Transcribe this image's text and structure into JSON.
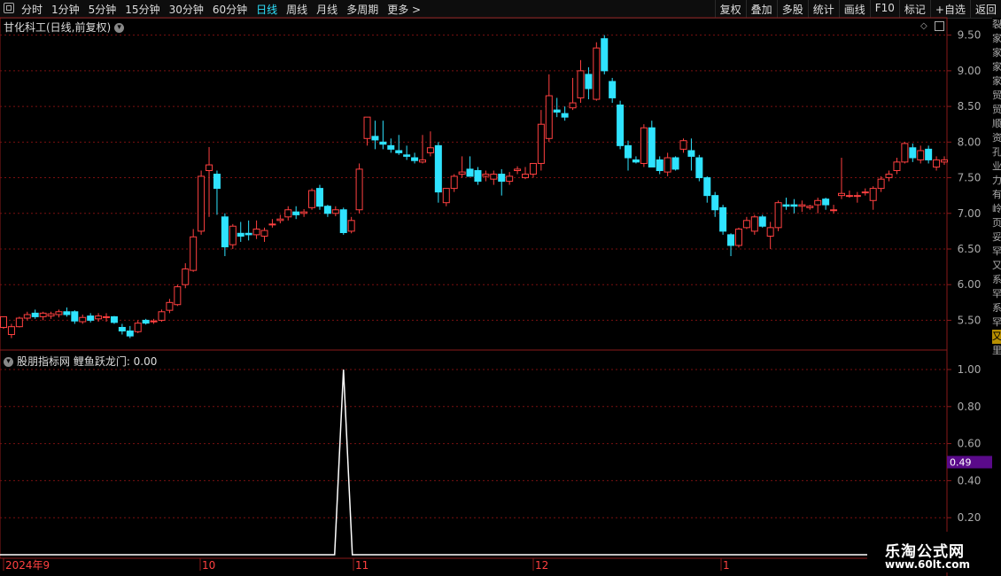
{
  "toolbar": {
    "periods": [
      "分时",
      "1分钟",
      "5分钟",
      "15分钟",
      "30分钟",
      "60分钟",
      "日线",
      "周线",
      "月线",
      "多周期",
      "更多 >"
    ],
    "active_period": "日线",
    "right_buttons": [
      "复权",
      "叠加",
      "多股",
      "统计",
      "画线",
      "F10",
      "标记",
      "+自选",
      "返回"
    ]
  },
  "main_chart": {
    "title": "甘化科工(日线,前复权)",
    "y_ticks": [
      "9.50",
      "9.00",
      "8.50",
      "8.00",
      "7.50",
      "7.00",
      "6.50",
      "6.00",
      "5.50"
    ],
    "y_values": [
      9.5,
      9.0,
      8.5,
      8.0,
      7.5,
      7.0,
      6.5,
      6.0,
      5.5
    ]
  },
  "indicator": {
    "title": "股朋指标网 鲤鱼跃龙门: 0.00",
    "y_ticks": [
      "1.00",
      "0.80",
      "0.60",
      "0.40",
      "0.20"
    ],
    "current_value": "0.49"
  },
  "x_axis": {
    "labels": [
      "2024年9",
      "10",
      "11",
      "12",
      "1"
    ]
  },
  "watermark": {
    "title": "乐淘公式网",
    "url": "www.60lt.com"
  },
  "sidebar_chars": [
    "裂",
    "家",
    "家",
    "家",
    "家",
    "贸",
    "贸",
    "顺",
    "资",
    "孔",
    "业",
    "力",
    "有",
    "岭",
    "",
    "页",
    "妥",
    "罕",
    "又",
    "系",
    "罕",
    "系",
    "罕",
    "又",
    "里"
  ],
  "colors": {
    "up": "#ff4040",
    "down": "#2fe3ff",
    "grid": "#7a1010",
    "axis": "#8a1a1a"
  },
  "chart_data": {
    "type": "candlestick",
    "ohlc": [
      [
        5.4,
        5.55,
        5.38,
        5.55
      ],
      [
        5.3,
        5.45,
        5.25,
        5.41
      ],
      [
        5.41,
        5.55,
        5.4,
        5.53
      ],
      [
        5.53,
        5.62,
        5.5,
        5.58
      ],
      [
        5.6,
        5.65,
        5.52,
        5.55
      ],
      [
        5.55,
        5.62,
        5.5,
        5.6
      ],
      [
        5.56,
        5.62,
        5.52,
        5.59
      ],
      [
        5.58,
        5.65,
        5.54,
        5.62
      ],
      [
        5.62,
        5.68,
        5.55,
        5.58
      ],
      [
        5.62,
        5.64,
        5.45,
        5.49
      ],
      [
        5.48,
        5.58,
        5.45,
        5.54
      ],
      [
        5.56,
        5.6,
        5.47,
        5.5
      ],
      [
        5.52,
        5.6,
        5.48,
        5.56
      ],
      [
        5.55,
        5.6,
        5.48,
        5.55
      ],
      [
        5.55,
        5.56,
        5.45,
        5.47
      ],
      [
        5.4,
        5.45,
        5.3,
        5.35
      ],
      [
        5.35,
        5.42,
        5.25,
        5.28
      ],
      [
        5.34,
        5.5,
        5.32,
        5.46
      ],
      [
        5.5,
        5.52,
        5.44,
        5.46
      ],
      [
        5.48,
        5.52,
        5.45,
        5.49
      ],
      [
        5.5,
        5.65,
        5.48,
        5.62
      ],
      [
        5.64,
        5.8,
        5.6,
        5.75
      ],
      [
        5.72,
        6.0,
        5.7,
        5.97
      ],
      [
        6.0,
        6.3,
        5.95,
        6.22
      ],
      [
        6.2,
        6.78,
        6.18,
        6.67
      ],
      [
        6.75,
        7.6,
        6.7,
        7.52
      ],
      [
        7.6,
        7.93,
        6.95,
        7.68
      ],
      [
        7.55,
        7.6,
        6.98,
        7.35
      ],
      [
        6.95,
        7.0,
        6.4,
        6.53
      ],
      [
        6.56,
        6.85,
        6.5,
        6.82
      ],
      [
        6.72,
        6.88,
        6.6,
        6.68
      ],
      [
        6.72,
        6.9,
        6.62,
        6.7
      ],
      [
        6.7,
        6.9,
        6.64,
        6.78
      ],
      [
        6.68,
        6.8,
        6.6,
        6.76
      ],
      [
        6.85,
        6.92,
        6.8,
        6.85
      ],
      [
        6.9,
        6.98,
        6.86,
        6.92
      ],
      [
        6.95,
        7.1,
        6.9,
        7.05
      ],
      [
        7.02,
        7.1,
        6.92,
        6.98
      ],
      [
        7.0,
        7.06,
        6.95,
        7.02
      ],
      [
        7.08,
        7.35,
        7.05,
        7.32
      ],
      [
        7.35,
        7.4,
        7.05,
        7.1
      ],
      [
        7.1,
        7.12,
        6.95,
        7.0
      ],
      [
        7.0,
        7.1,
        6.96,
        7.05
      ],
      [
        7.05,
        7.08,
        6.7,
        6.73
      ],
      [
        6.75,
        6.95,
        6.72,
        6.9
      ],
      [
        7.05,
        7.7,
        7.0,
        7.62
      ],
      [
        8.05,
        8.35,
        7.95,
        8.35
      ],
      [
        8.08,
        8.3,
        7.9,
        8.03
      ],
      [
        8.0,
        8.3,
        7.9,
        7.97
      ],
      [
        7.95,
        8.05,
        7.85,
        7.9
      ],
      [
        7.88,
        8.1,
        7.82,
        7.85
      ],
      [
        7.82,
        7.95,
        7.75,
        7.8
      ],
      [
        7.78,
        7.85,
        7.7,
        7.74
      ],
      [
        7.72,
        8.1,
        7.7,
        7.75
      ],
      [
        7.85,
        8.15,
        7.8,
        7.92
      ],
      [
        7.95,
        8.0,
        7.15,
        7.3
      ],
      [
        7.15,
        7.3,
        7.1,
        7.35
      ],
      [
        7.35,
        7.55,
        7.3,
        7.52
      ],
      [
        7.55,
        7.8,
        7.5,
        7.58
      ],
      [
        7.62,
        7.8,
        7.58,
        7.52
      ],
      [
        7.6,
        7.65,
        7.4,
        7.45
      ],
      [
        7.52,
        7.6,
        7.45,
        7.55
      ],
      [
        7.48,
        7.6,
        7.4,
        7.55
      ],
      [
        7.55,
        7.62,
        7.25,
        7.45
      ],
      [
        7.45,
        7.58,
        7.4,
        7.52
      ],
      [
        7.6,
        7.66,
        7.55,
        7.62
      ],
      [
        7.5,
        7.65,
        7.48,
        7.55
      ],
      [
        7.55,
        7.7,
        7.5,
        7.7
      ],
      [
        7.7,
        8.45,
        7.6,
        8.25
      ],
      [
        8.05,
        8.95,
        8.0,
        8.65
      ],
      [
        8.45,
        8.62,
        8.35,
        8.42
      ],
      [
        8.4,
        8.5,
        8.3,
        8.35
      ],
      [
        8.48,
        8.9,
        8.45,
        8.55
      ],
      [
        8.62,
        9.15,
        8.55,
        9.0
      ],
      [
        8.95,
        9.05,
        8.6,
        8.75
      ],
      [
        8.6,
        9.4,
        8.58,
        9.32
      ],
      [
        9.45,
        9.5,
        8.95,
        9.0
      ],
      [
        8.85,
        8.9,
        8.55,
        8.62
      ],
      [
        8.52,
        8.58,
        7.9,
        7.95
      ],
      [
        7.95,
        8.02,
        7.6,
        7.78
      ],
      [
        7.75,
        7.8,
        7.7,
        7.72
      ],
      [
        7.7,
        8.25,
        7.65,
        8.2
      ],
      [
        8.2,
        8.3,
        7.68,
        7.65
      ],
      [
        7.75,
        7.8,
        7.55,
        7.6
      ],
      [
        7.58,
        7.85,
        7.52,
        7.78
      ],
      [
        7.78,
        7.8,
        7.6,
        7.62
      ],
      [
        7.9,
        8.05,
        7.85,
        8.02
      ],
      [
        7.88,
        8.05,
        7.6,
        7.8
      ],
      [
        7.78,
        7.82,
        7.45,
        7.5
      ],
      [
        7.5,
        7.52,
        7.15,
        7.25
      ],
      [
        7.25,
        7.3,
        6.95,
        7.05
      ],
      [
        7.08,
        7.12,
        6.7,
        6.75
      ],
      [
        6.7,
        6.72,
        6.4,
        6.55
      ],
      [
        6.55,
        6.8,
        6.52,
        6.78
      ],
      [
        6.8,
        6.95,
        6.78,
        6.9
      ],
      [
        6.75,
        6.98,
        6.7,
        6.95
      ],
      [
        6.95,
        6.98,
        6.8,
        6.82
      ],
      [
        6.68,
        6.88,
        6.5,
        6.8
      ],
      [
        6.8,
        7.18,
        6.75,
        7.15
      ],
      [
        7.12,
        7.22,
        7.05,
        7.1
      ],
      [
        7.12,
        7.2,
        7.0,
        7.1
      ],
      [
        7.1,
        7.18,
        7.02,
        7.12
      ],
      [
        7.08,
        7.12,
        7.05,
        7.1
      ],
      [
        7.12,
        7.22,
        7.0,
        7.18
      ],
      [
        7.2,
        7.22,
        7.05,
        7.12
      ],
      [
        7.05,
        7.12,
        7.0,
        7.05
      ],
      [
        7.25,
        7.78,
        7.2,
        7.28
      ],
      [
        7.25,
        7.32,
        7.22,
        7.25
      ],
      [
        7.25,
        7.3,
        7.15,
        7.25
      ],
      [
        7.3,
        7.35,
        7.25,
        7.3
      ],
      [
        7.18,
        7.38,
        7.05,
        7.35
      ],
      [
        7.35,
        7.52,
        7.3,
        7.48
      ],
      [
        7.5,
        7.6,
        7.45,
        7.55
      ],
      [
        7.6,
        7.78,
        7.55,
        7.72
      ],
      [
        7.72,
        8.0,
        7.7,
        7.98
      ],
      [
        7.92,
        7.98,
        7.72,
        7.78
      ],
      [
        7.75,
        7.95,
        7.7,
        7.88
      ],
      [
        7.9,
        7.95,
        7.7,
        7.75
      ],
      [
        7.65,
        7.8,
        7.6,
        7.75
      ],
      [
        7.72,
        7.8,
        7.68,
        7.75
      ]
    ],
    "indicator_spike_index": 43,
    "indicator_values_note": ""
  }
}
